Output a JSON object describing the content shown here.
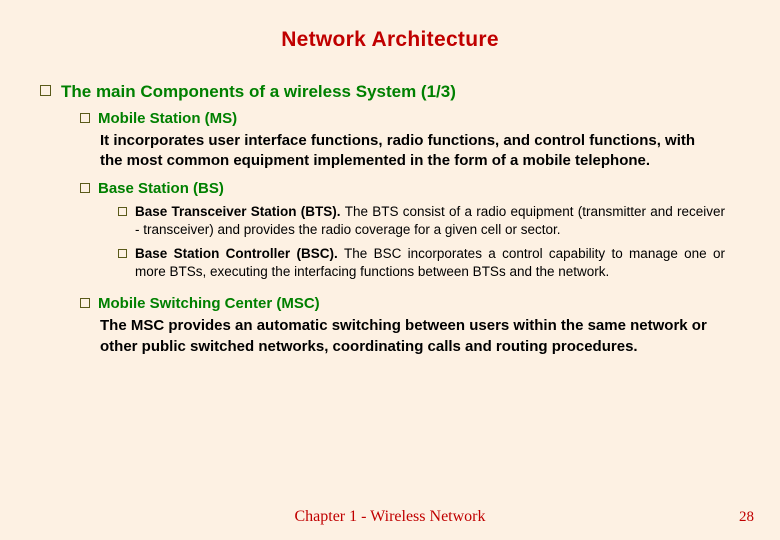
{
  "title": "Network Architecture",
  "heading": "The main Components of a wireless System (1/3)",
  "items": {
    "ms_title": "Mobile Station (MS)",
    "ms_body": "It incorporates user interface functions, radio functions, and control functions, with the most common equipment implemented in the form of a mobile telephone.",
    "bs_title": "Base Station (BS)",
    "bts_lead": "Base Transceiver Station (BTS). ",
    "bts_body": "The BTS consist of a radio equipment (transmitter and receiver - transceiver) and provides the radio coverage for a given cell or sector.",
    "bsc_lead": "Base Station Controller (BSC). ",
    "bsc_body": "The BSC incorporates a control capability to manage one or more BTSs, executing the interfacing functions between BTSs and the network.",
    "msc_title": "Mobile Switching Center (MSC)",
    "msc_body": "The MSC provides an automatic switching between users within the same network or other public switched networks, coordinating calls and routing procedures."
  },
  "footer": "Chapter 1 - Wireless Network",
  "page": "28"
}
